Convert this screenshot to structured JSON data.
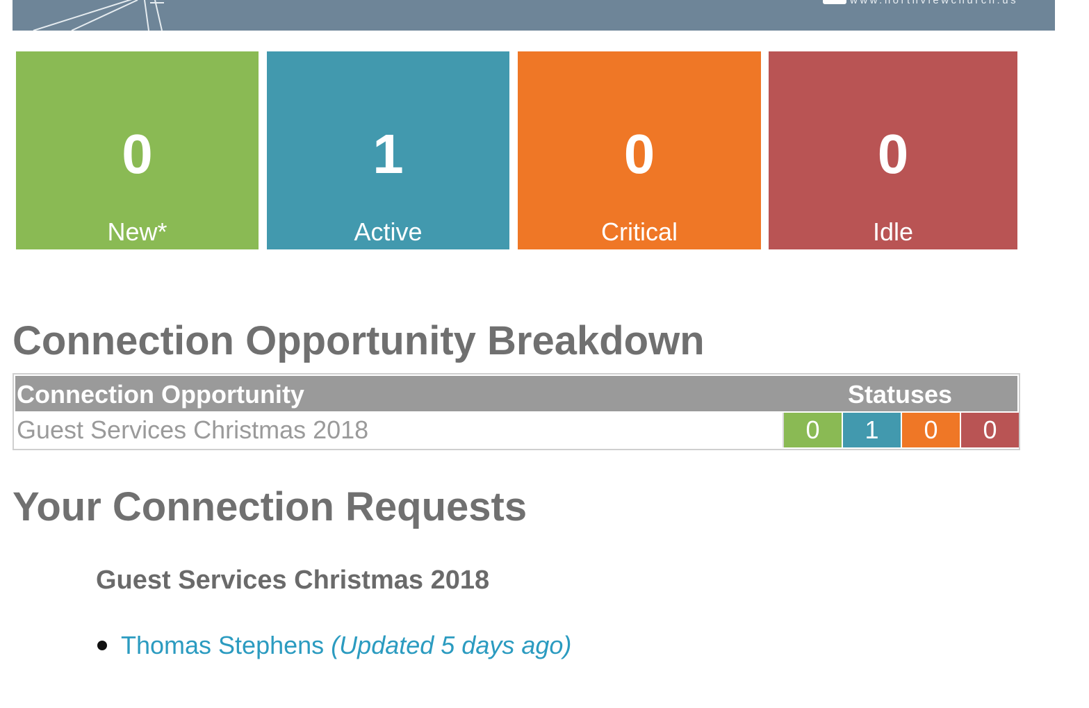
{
  "banner": {
    "url_text": "www.northviewchurch.us",
    "bg_color": "#6e8598"
  },
  "tiles": [
    {
      "count": "0",
      "label": "New*",
      "color": "#8aba54"
    },
    {
      "count": "1",
      "label": "Active",
      "color": "#4299ae"
    },
    {
      "count": "0",
      "label": "Critical",
      "color": "#ef7726"
    },
    {
      "count": "0",
      "label": "Idle",
      "color": "#b95454"
    }
  ],
  "breakdown": {
    "title": "Connection Opportunity Breakdown",
    "columns": [
      "Connection Opportunity",
      "Statuses"
    ],
    "rows": [
      {
        "name": "Guest Services Christmas 2018",
        "statuses": [
          {
            "value": "0",
            "color": "#8aba54"
          },
          {
            "value": "1",
            "color": "#4299ae"
          },
          {
            "value": "0",
            "color": "#ef7726"
          },
          {
            "value": "0",
            "color": "#b95454"
          }
        ]
      }
    ]
  },
  "requests": {
    "title": "Your Connection Requests",
    "group_title": "Guest Services Christmas 2018",
    "items": [
      {
        "name": "Thomas Stephens",
        "updated": "(Updated 5 days ago)"
      }
    ]
  }
}
